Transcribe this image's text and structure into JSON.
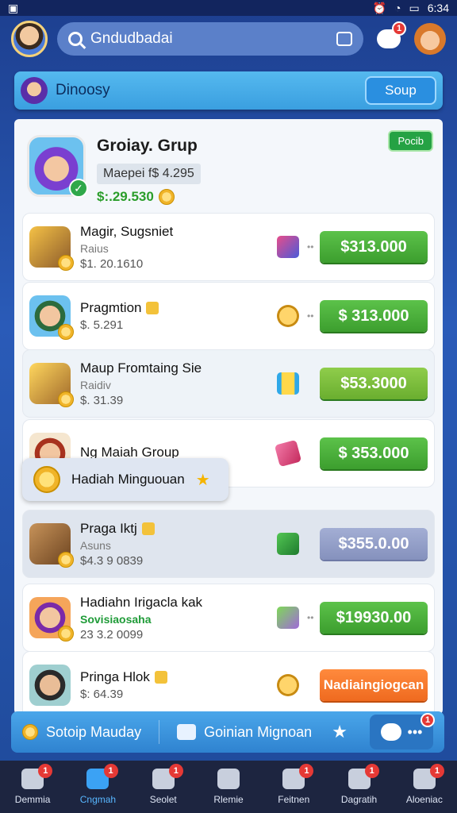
{
  "status": {
    "time": "6:34"
  },
  "topbar": {
    "search_text": "Gndudbadai",
    "chat_badge": "1"
  },
  "group_bar": {
    "title": "Dinoosy",
    "button": "Soup"
  },
  "header": {
    "title": "Groiay. Grup",
    "sub": "Maepei f$ 4.295",
    "money": "$:.29.530",
    "tag": "Pocib"
  },
  "rows": [
    {
      "name": "Magir, Sugsniet",
      "label": "Raius",
      "value": "$1. 20.1610",
      "price": "$313.000"
    },
    {
      "name": "Pragmtion",
      "label": "",
      "value": "$. 5.291",
      "price": "$ 313.000"
    },
    {
      "name": "Maup Fromtaing Sie",
      "label": "Raidiv",
      "value": "$. 31.39",
      "price": "$53.3000"
    },
    {
      "name": "Ng Maiah Group",
      "label": "",
      "value": "",
      "price": "$ 353.000"
    },
    {
      "name": "Praga Iktj",
      "label": "Asuns",
      "value": "$4.3 9 0839",
      "price": "$355.0.00"
    },
    {
      "name": "Hadiahn Irigacla kak",
      "label": "Sovisiaosaha",
      "value": "23 3.2 0099",
      "price": "$19930.00"
    },
    {
      "name": "Pringa Hlok",
      "label": "",
      "value": "$: 64.39",
      "price": "Nadiaingiogcan"
    }
  ],
  "toast": {
    "text": "Hadiah Minguouan"
  },
  "bottom_bar": {
    "left": "Sotoip Mauday",
    "middle": "Goinian Mignoan",
    "badge": "1"
  },
  "nav": [
    {
      "label": "Demmia",
      "badge": "1"
    },
    {
      "label": "Cngmah",
      "badge": "1"
    },
    {
      "label": "Seolet",
      "badge": "1"
    },
    {
      "label": "Rlemie",
      "badge": ""
    },
    {
      "label": "Feitnen",
      "badge": "1"
    },
    {
      "label": "Dagratih",
      "badge": "1"
    },
    {
      "label": "Aloeniac",
      "badge": "1"
    }
  ]
}
